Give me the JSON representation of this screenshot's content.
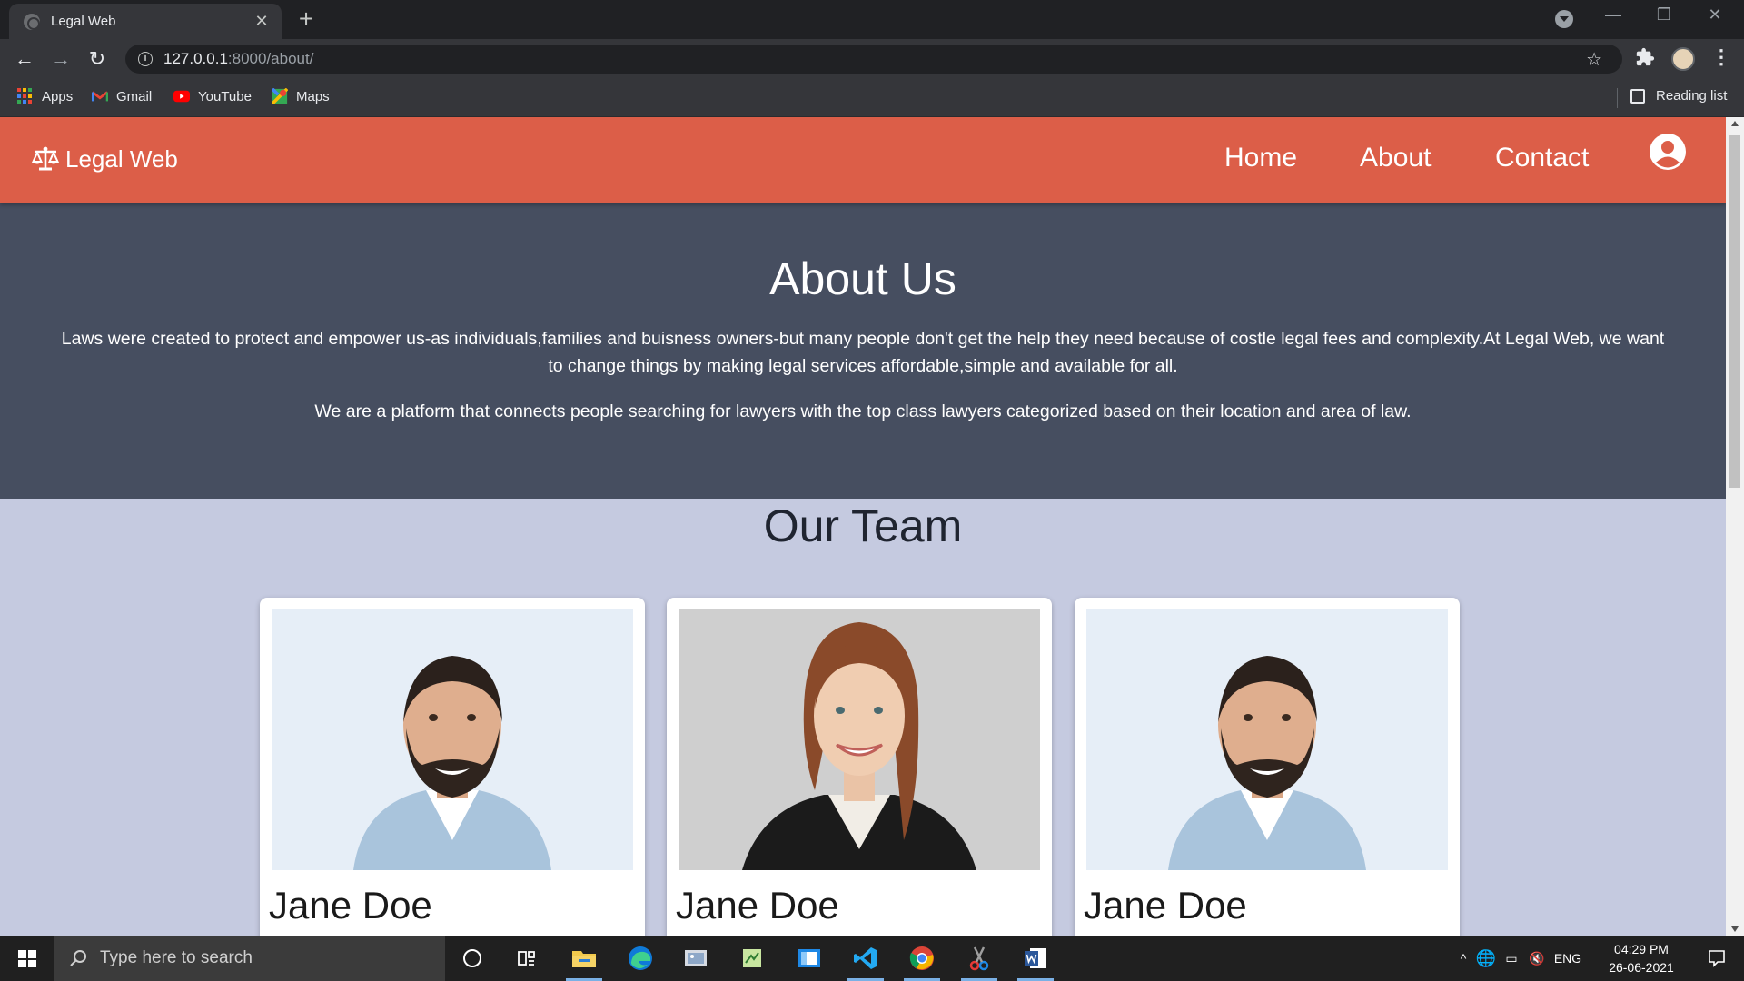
{
  "browser": {
    "tab_title": "Legal Web",
    "tab_close": "✕",
    "new_tab": "+",
    "url_host": "127.0.0.1",
    "url_path": ":8000/about/",
    "bookmarks": [
      "Apps",
      "Gmail",
      "YouTube",
      "Maps"
    ],
    "reading_list": "Reading list"
  },
  "site": {
    "brand": "Legal Web",
    "nav": [
      "Home",
      "About",
      "Contact"
    ],
    "nav_color": "#dc5e48"
  },
  "about": {
    "title": "About Us",
    "paragraph1": "Laws were created to protect and empower us-as individuals,families and buisness owners-but many people don't get the help they need because of costle legal fees and complexity.At Legal Web, we want to change things by making legal services affordable,simple and available for all.",
    "paragraph2": "We are a platform that connects people searching for lawyers with the top class lawyers categorized based on their location and area of law.",
    "background": "#464e60"
  },
  "team": {
    "title": "Our Team",
    "members": [
      {
        "name": "Jane Doe",
        "photo": "man-portrait"
      },
      {
        "name": "Jane Doe",
        "photo": "woman-portrait"
      },
      {
        "name": "Jane Doe",
        "photo": "man-portrait"
      }
    ]
  },
  "taskbar": {
    "search_placeholder": "Type here to search",
    "language": "ENG",
    "time": "04:29 PM",
    "date": "26-06-2021"
  }
}
